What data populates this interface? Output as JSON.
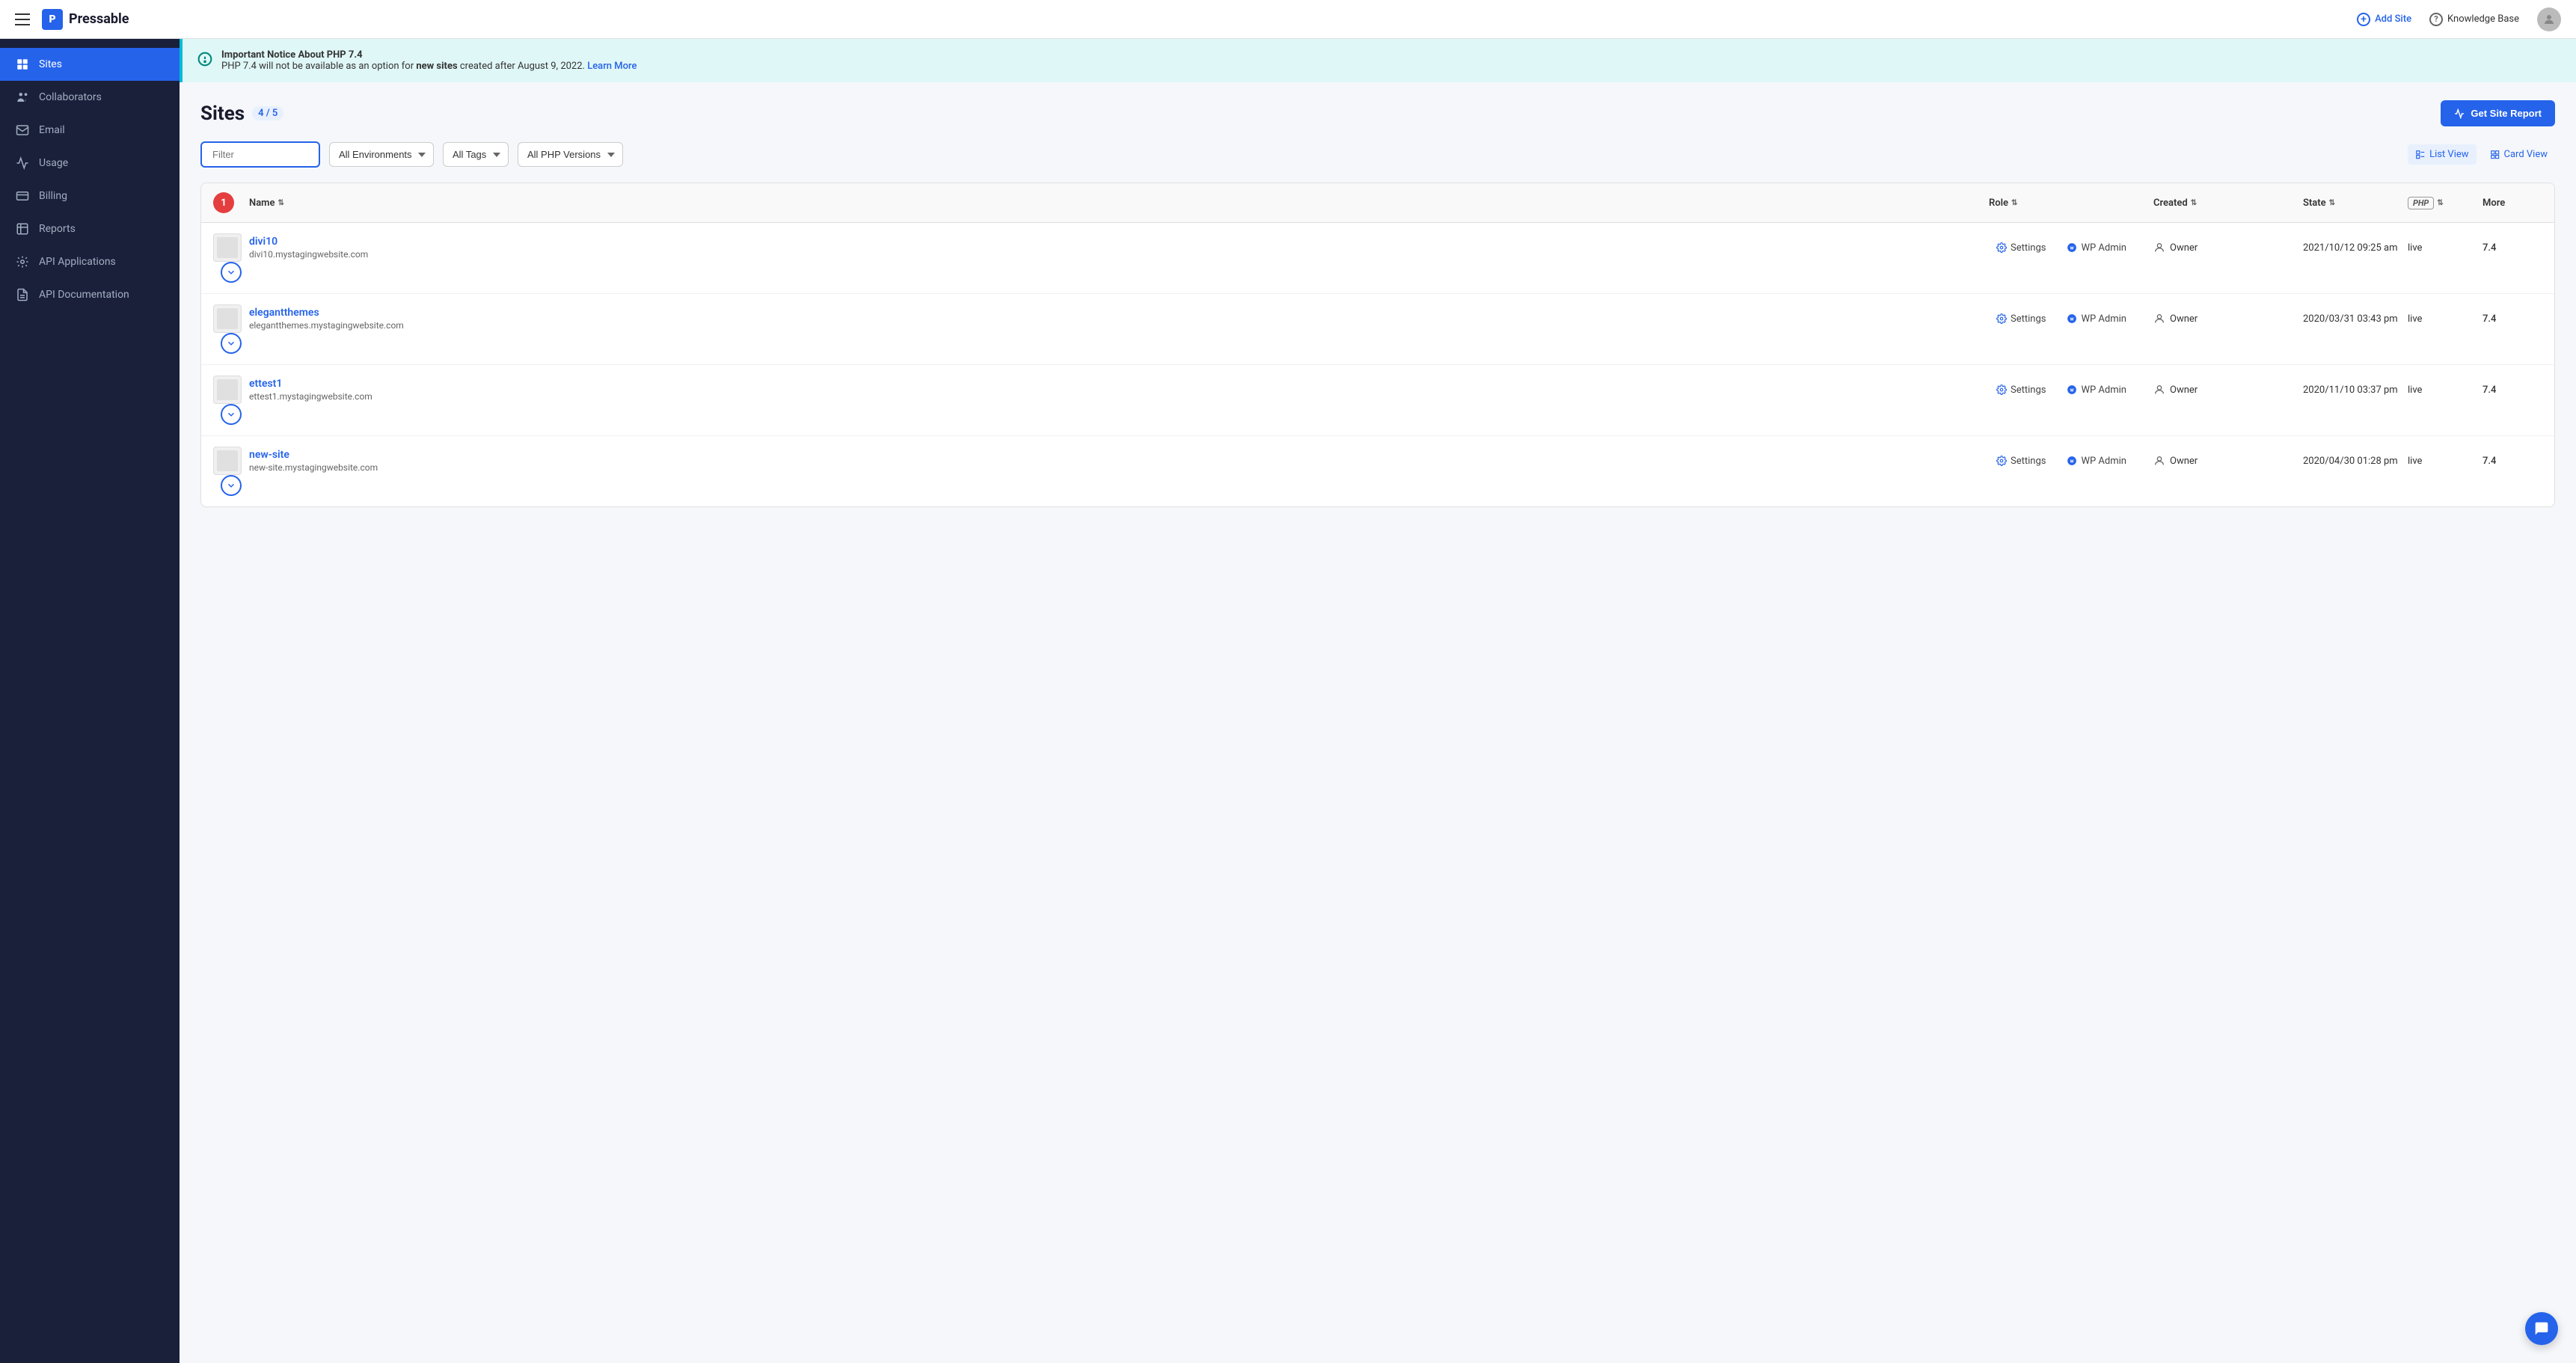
{
  "topnav": {
    "logo_text": "Pressable",
    "add_site_label": "Add Site",
    "knowledge_base_label": "Knowledge Base"
  },
  "sidebar": {
    "items": [
      {
        "id": "sites",
        "label": "Sites",
        "active": true
      },
      {
        "id": "collaborators",
        "label": "Collaborators",
        "active": false
      },
      {
        "id": "email",
        "label": "Email",
        "active": false
      },
      {
        "id": "usage",
        "label": "Usage",
        "active": false
      },
      {
        "id": "billing",
        "label": "Billing",
        "active": false
      },
      {
        "id": "reports",
        "label": "Reports",
        "active": false
      },
      {
        "id": "api-applications",
        "label": "API Applications",
        "active": false
      },
      {
        "id": "api-documentation",
        "label": "API Documentation",
        "active": false
      }
    ]
  },
  "notice": {
    "title": "Important Notice About PHP 7.4",
    "text": "PHP 7.4 will not be available as an option for ",
    "bold": "new sites",
    "text2": " created after August 9, 2022.",
    "link_label": "Learn More",
    "link_href": "#"
  },
  "page": {
    "title": "Sites",
    "count": "4 / 5",
    "get_report_label": "Get Site Report"
  },
  "filters": {
    "filter_placeholder": "Filter",
    "env_label": "All Environments",
    "tags_label": "All Tags",
    "php_label": "All PHP Versions",
    "list_view_label": "List View",
    "card_view_label": "Card View"
  },
  "table": {
    "columns": {
      "name": "Name",
      "role": "Role",
      "created": "Created",
      "state": "State",
      "php": "PHP",
      "more": "More"
    },
    "rows": [
      {
        "name": "divi10",
        "url": "divi10.mystagingwebsite.com",
        "role": "Owner",
        "created": "2021/10/12 09:25 am",
        "state": "live",
        "php": "7.4"
      },
      {
        "name": "elegantthemes",
        "url": "elegantthemes.mystagingwebsite.com",
        "role": "Owner",
        "created": "2020/03/31 03:43 pm",
        "state": "live",
        "php": "7.4"
      },
      {
        "name": "ettest1",
        "url": "ettest1.mystagingwebsite.com",
        "role": "Owner",
        "created": "2020/11/10 03:37 pm",
        "state": "live",
        "php": "7.4"
      },
      {
        "name": "new-site",
        "url": "new-site.mystagingwebsite.com",
        "role": "Owner",
        "created": "2020/04/30 01:28 pm",
        "state": "live",
        "php": "7.4"
      }
    ],
    "badge_count": "1",
    "settings_label": "Settings",
    "wp_admin_label": "WP Admin"
  },
  "colors": {
    "primary": "#2563eb",
    "sidebar_bg": "#1a1f3a",
    "active_bg": "#2563eb",
    "notice_bg": "#e0f7f7",
    "badge_red": "#e53e3e"
  }
}
